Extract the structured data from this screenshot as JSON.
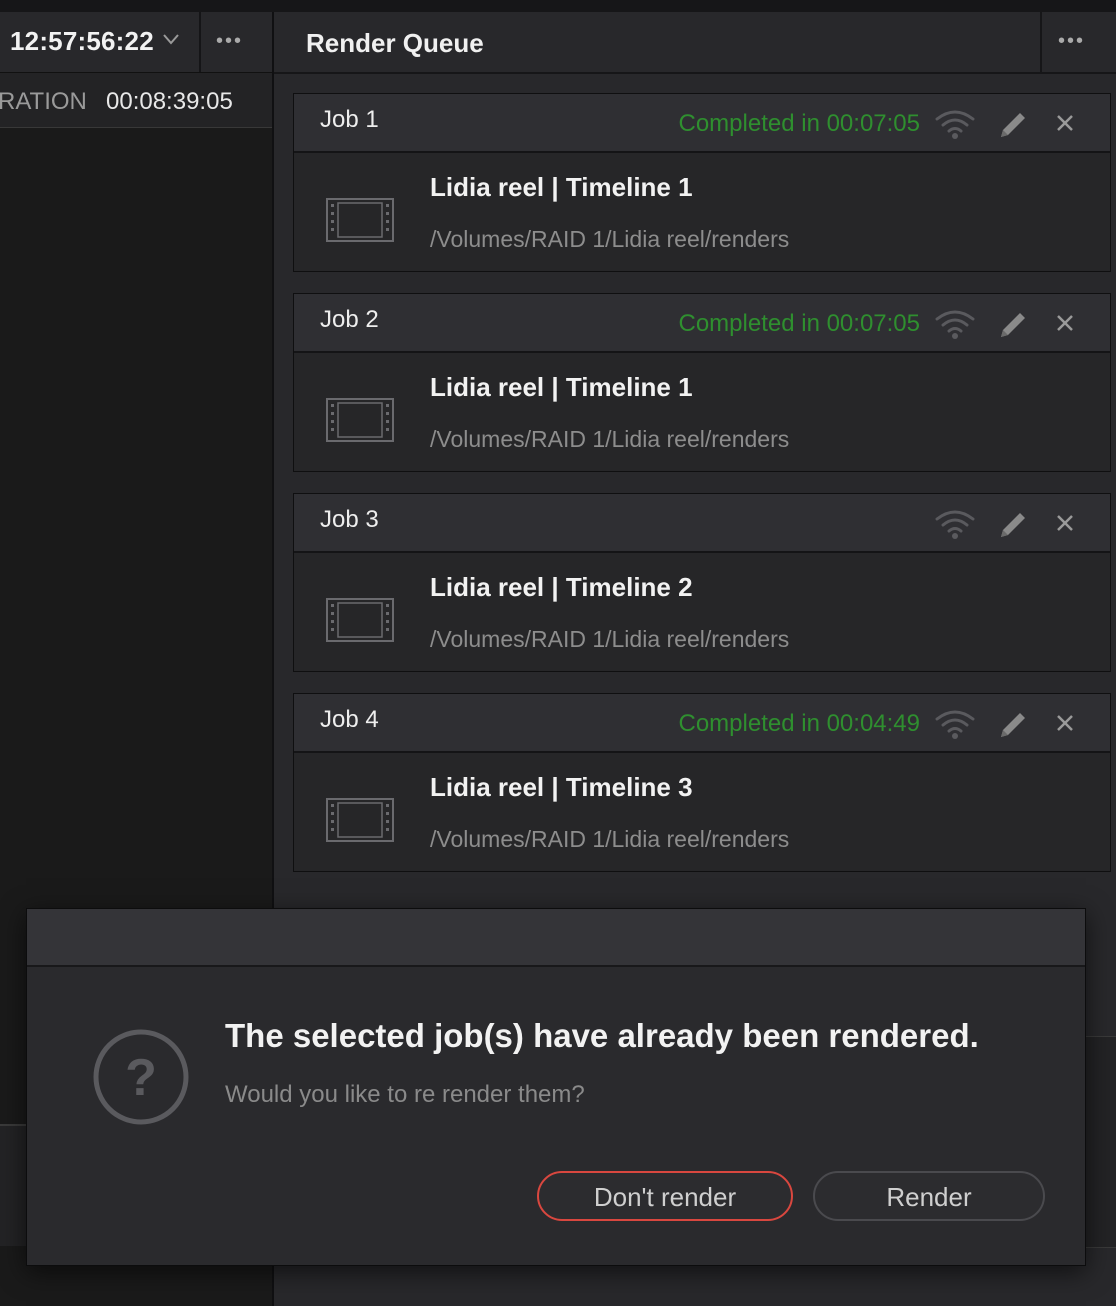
{
  "left_panel": {
    "timecode": "12:57:56:22",
    "more_label": "•••",
    "duration_label": "RATION",
    "duration_value": "00:08:39:05"
  },
  "render_queue": {
    "title": "Render Queue",
    "more_label": "•••",
    "jobs": [
      {
        "name": "Job 1",
        "status": "Completed in 00:07:05",
        "timeline": "Lidia reel | Timeline 1",
        "path": "/Volumes/RAID 1/Lidia reel/renders"
      },
      {
        "name": "Job 2",
        "status": "Completed in 00:07:05",
        "timeline": "Lidia reel | Timeline 1",
        "path": "/Volumes/RAID 1/Lidia reel/renders"
      },
      {
        "name": "Job 3",
        "status": "",
        "timeline": "Lidia reel | Timeline 2",
        "path": "/Volumes/RAID 1/Lidia reel/renders"
      },
      {
        "name": "Job 4",
        "status": "Completed in 00:04:49",
        "timeline": "Lidia reel | Timeline 3",
        "path": "/Volumes/RAID 1/Lidia reel/renders"
      }
    ]
  },
  "dialog": {
    "title": "The selected job(s) have already been rendered.",
    "message": "Would you like to re render them?",
    "dont_render_label": "Don't render",
    "render_label": "Render",
    "icon": "question-mark-icon"
  },
  "colors": {
    "status_green": "#2f8f2f",
    "cancel_outline": "#d9473f"
  }
}
